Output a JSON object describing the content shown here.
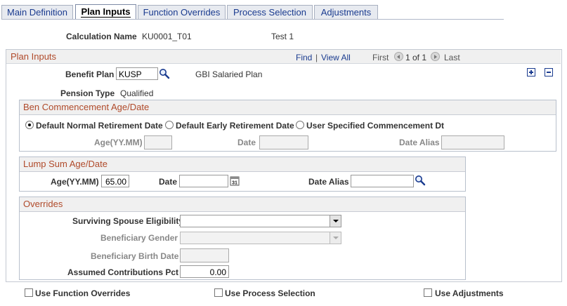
{
  "tabs": [
    {
      "label": "Main Definition"
    },
    {
      "label": "Plan Inputs"
    },
    {
      "label": "Function Overrides"
    },
    {
      "label": "Process Selection"
    },
    {
      "label": "Adjustments"
    }
  ],
  "header": {
    "calc_label": "Calculation Name",
    "calc_value": "KU0001_T01",
    "calc_desc": "Test 1"
  },
  "plan_inputs": {
    "title": "Plan Inputs",
    "nav": {
      "find": "Find",
      "sep": "|",
      "view_all": "View All",
      "first": "First",
      "count": "1 of 1",
      "last": "Last"
    },
    "benefit_plan_label": "Benefit Plan",
    "benefit_plan_value": "KUSP",
    "benefit_plan_desc": "GBI Salaried Plan",
    "pension_type_label": "Pension Type",
    "pension_type_value": "Qualified"
  },
  "ben_commencement": {
    "title": "Ben Commencement Age/Date",
    "radio_normal": "Default Normal Retirement Date",
    "radio_early": "Default Early Retirement Date",
    "radio_user": "User Specified Commencement Dt",
    "selected": "normal",
    "age_label": "Age(YY.MM)",
    "date_label": "Date",
    "alias_label": "Date Alias"
  },
  "lump_sum": {
    "title": "Lump Sum Age/Date",
    "age_label": "Age(YY.MM)",
    "age_value": "65.00",
    "date_label": "Date",
    "alias_label": "Date Alias"
  },
  "overrides": {
    "title": "Overrides",
    "spouse_label": "Surviving Spouse Eligibility",
    "gender_label": "Beneficiary Gender",
    "birth_label": "Beneficiary Birth Date",
    "contrib_label": "Assumed Contributions Pct",
    "contrib_value": "0.00"
  },
  "footer": {
    "use_function": "Use Function Overrides",
    "use_process": "Use Process Selection",
    "use_adjust": "Use Adjustments"
  }
}
